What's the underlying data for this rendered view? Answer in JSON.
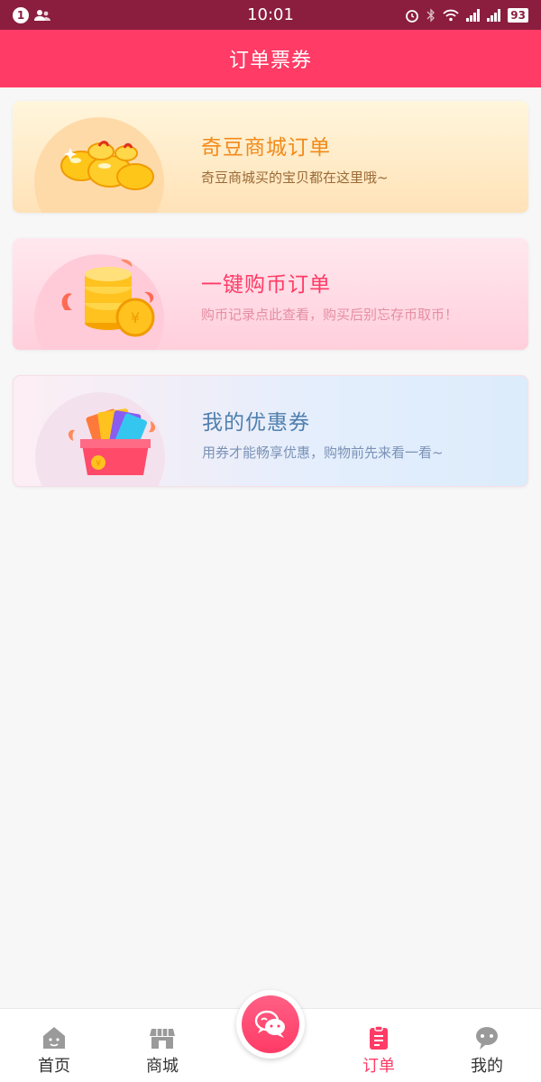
{
  "status_bar": {
    "notification_count": "1",
    "time": "10:01",
    "battery": "93"
  },
  "header": {
    "title": "订单票券"
  },
  "cards": [
    {
      "title": "奇豆商城订单",
      "subtitle": "奇豆商城买的宝贝都在这里哦~",
      "icon": "golden-beans-icon"
    },
    {
      "title": "一键购币订单",
      "subtitle": "购币记录点此查看，购买后别忘存币取币！",
      "icon": "coin-stack-icon"
    },
    {
      "title": "我的优惠券",
      "subtitle": "用券才能畅享优惠，购物前先来看一看~",
      "icon": "coupon-gift-box-icon"
    }
  ],
  "bottom_nav": {
    "items": [
      {
        "label": "首页",
        "icon": "home-icon"
      },
      {
        "label": "商城",
        "icon": "store-icon"
      },
      {
        "label": "订单",
        "icon": "order-icon",
        "active": true
      },
      {
        "label": "我的",
        "icon": "profile-icon"
      }
    ],
    "center_icon": "chat-bubble-icon"
  },
  "colors": {
    "accent": "#ff3b66",
    "status_bar": "#8b1e3f"
  }
}
